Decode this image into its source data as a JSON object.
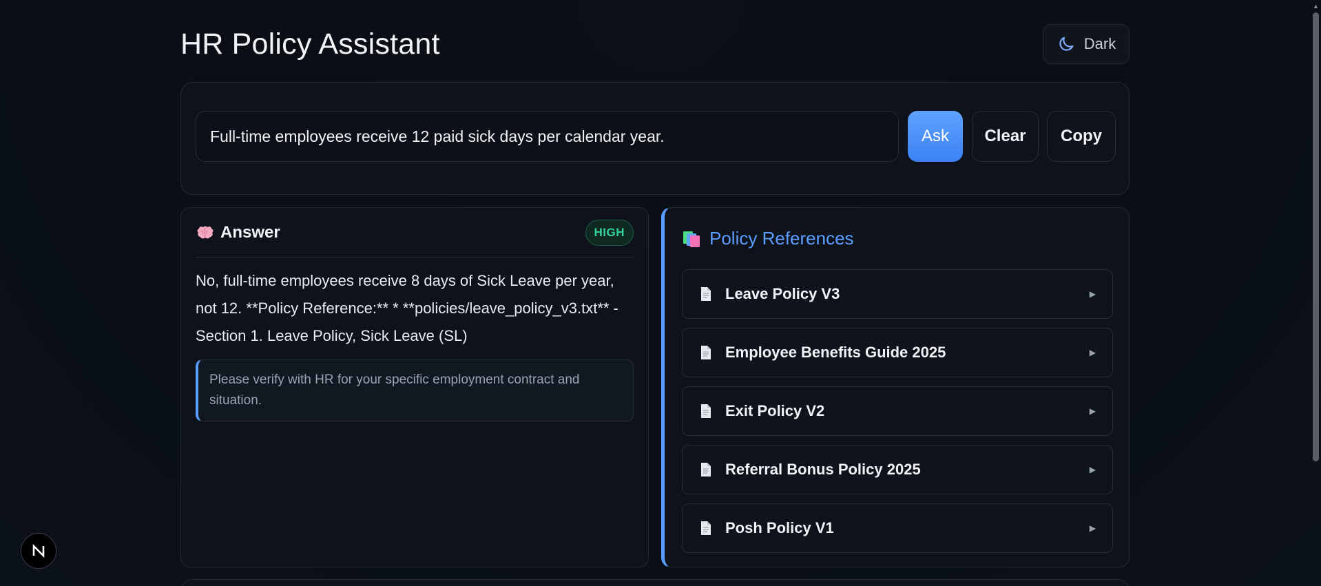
{
  "header": {
    "title": "HR Policy Assistant",
    "theme_toggle_label": "Dark",
    "theme_icon": "moon-icon"
  },
  "ask": {
    "question_value": "Full-time employees receive 12 paid sick days per calendar year.",
    "ask_label": "Ask",
    "clear_label": "Clear",
    "copy_label": "Copy"
  },
  "answer": {
    "title": "Answer",
    "icon": "brain-icon",
    "confidence": "HIGH",
    "text": "No, full-time employees receive 8 days of Sick Leave per year, not 12. **Policy Reference:** * **policies/leave_policy_v3.txt** - Section 1. Leave Policy, Sick Leave (SL)",
    "disclaimer": "Please verify with HR for your specific employment contract and situation."
  },
  "references": {
    "title": "Policy References",
    "icon": "books-icon",
    "items": [
      {
        "label": "Leave Policy V3"
      },
      {
        "label": "Employee Benefits Guide 2025"
      },
      {
        "label": "Exit Policy V2"
      },
      {
        "label": "Referral Bonus Policy 2025"
      },
      {
        "label": "Posh Policy V1"
      }
    ]
  },
  "colors": {
    "accent": "#5b9cff",
    "ask_button": "#3b82f6",
    "badge_high": "#34d399",
    "background": "#0a0e15"
  }
}
